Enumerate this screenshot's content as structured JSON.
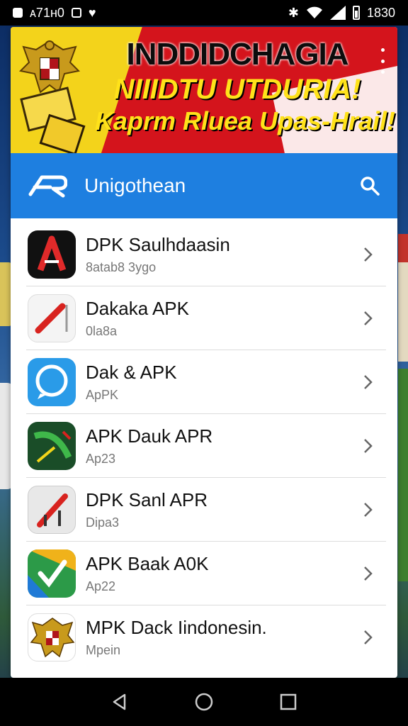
{
  "status_bar": {
    "left_text": "ᴀ71ʜ0",
    "time": "1830",
    "icons": [
      "notification-icon",
      "message-icon",
      "heart-icon",
      "bluetooth-icon",
      "wifi-icon",
      "signal-icon",
      "battery-icon"
    ]
  },
  "banner": {
    "line1": "INDDIDCHAGIA",
    "line2": "NIIIDTU UTDURIA!",
    "line3": "Kaprm Rluea Upas-Hrail!"
  },
  "app_bar": {
    "title": "Unigothean",
    "color": "#1e7fe0"
  },
  "apps": [
    {
      "name": "DPK Saulhdaasin",
      "sub": "8atab8 3ygo",
      "icon": "letter-a-icon"
    },
    {
      "name": "Dakaka APK",
      "sub": "0la8a",
      "icon": "pencil-icon"
    },
    {
      "name": "Dak & APK",
      "sub": "ApPK",
      "icon": "chat-bubble-icon"
    },
    {
      "name": "APK Dauk APR",
      "sub": "Ap23",
      "icon": "green-arrow-icon"
    },
    {
      "name": "DPK Sanl APR",
      "sub": "Dipa3",
      "icon": "red-stylus-icon"
    },
    {
      "name": "APK Baak A0K",
      "sub": "Ap22",
      "icon": "checkmark-icon"
    },
    {
      "name": "MPK Dack Iindonesin.",
      "sub": "Mpein",
      "icon": "garuda-emblem-icon"
    }
  ],
  "nav": [
    "back-icon",
    "home-icon",
    "recents-icon"
  ]
}
